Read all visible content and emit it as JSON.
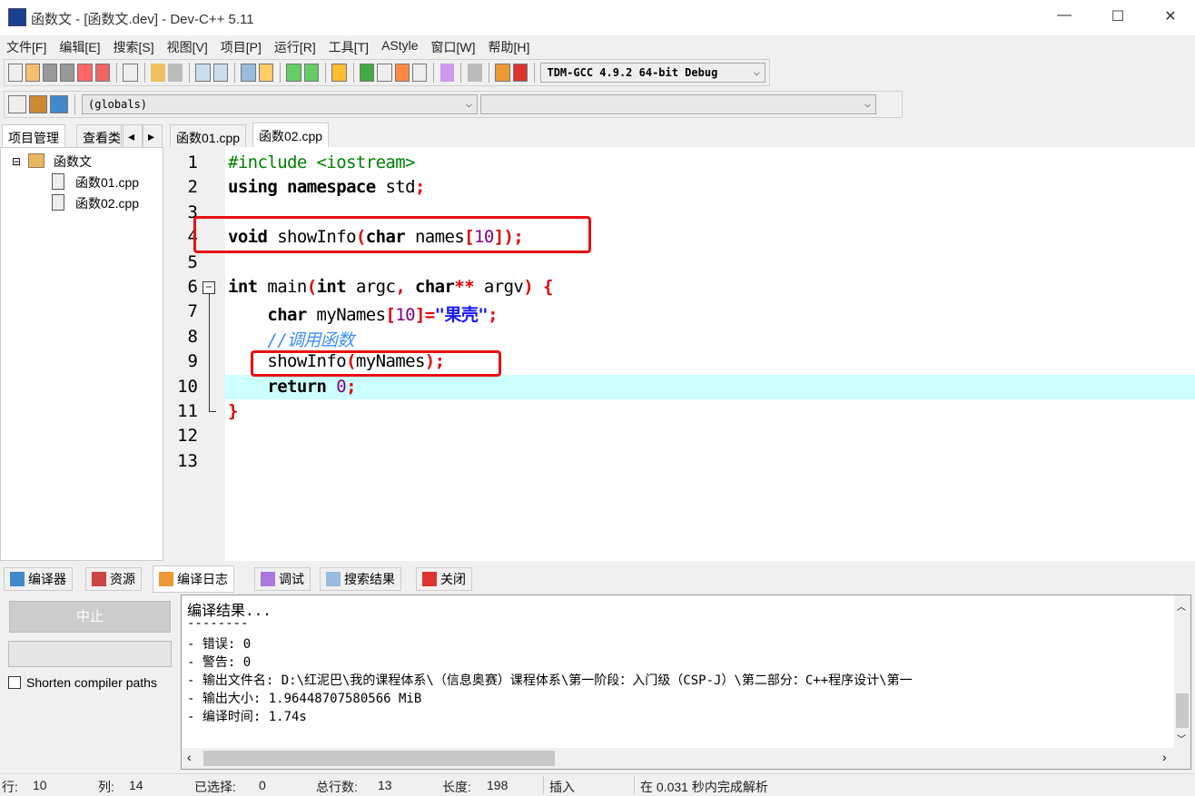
{
  "window": {
    "title": "函数文 - [函数文.dev] - Dev-C++ 5.11",
    "minimize": "—",
    "maximize": "☐",
    "close": "✕"
  },
  "menu": [
    "文件[F]",
    "编辑[E]",
    "搜索[S]",
    "视图[V]",
    "项目[P]",
    "运行[R]",
    "工具[T]",
    "AStyle",
    "窗口[W]",
    "帮助[H]"
  ],
  "toolbar": {
    "compiler": "TDM-GCC 4.9.2 64-bit Debug",
    "scope": "(globals)",
    "symbol": ""
  },
  "left_tabs": [
    "项目管理",
    "查看类"
  ],
  "project": {
    "name": "函数文",
    "files": [
      "函数01.cpp",
      "函数02.cpp"
    ]
  },
  "editor_tabs": [
    "函数01.cpp",
    "函数02.cpp"
  ],
  "active_tab": 1,
  "code": [
    [
      [
        "pp",
        "#include <iostream>"
      ]
    ],
    [
      [
        "kw",
        "using"
      ],
      [
        "id",
        " "
      ],
      [
        "kw",
        "namespace"
      ],
      [
        "id",
        " std"
      ],
      [
        "sym",
        ";"
      ]
    ],
    [],
    [
      [
        "kw",
        "void"
      ],
      [
        "id",
        " showInfo"
      ],
      [
        "sym",
        "("
      ],
      [
        "kw",
        "char"
      ],
      [
        "id",
        " names"
      ],
      [
        "sym",
        "["
      ],
      [
        "num",
        "10"
      ],
      [
        "sym",
        "]);"
      ]
    ],
    [],
    [
      [
        "kw",
        "int"
      ],
      [
        "id",
        " main"
      ],
      [
        "sym",
        "("
      ],
      [
        "kw",
        "int"
      ],
      [
        "id",
        " argc"
      ],
      [
        "sym",
        ", "
      ],
      [
        "kw",
        "char"
      ],
      [
        "sym",
        "**"
      ],
      [
        "id",
        " argv"
      ],
      [
        "sym",
        ")"
      ],
      [
        "id",
        " "
      ],
      [
        "sym",
        "{"
      ]
    ],
    [
      [
        "id",
        "    "
      ],
      [
        "kw",
        "char"
      ],
      [
        "id",
        " myNames"
      ],
      [
        "sym",
        "["
      ],
      [
        "num",
        "10"
      ],
      [
        "sym",
        "]="
      ],
      [
        "str",
        "\"果壳\""
      ],
      [
        "sym",
        ";"
      ]
    ],
    [
      [
        "id",
        "    "
      ],
      [
        "cm",
        "//调用函数"
      ]
    ],
    [
      [
        "id",
        "    showInfo"
      ],
      [
        "sym",
        "("
      ],
      [
        "id",
        "myNames"
      ],
      [
        "sym",
        ");"
      ]
    ],
    [
      [
        "id",
        "    "
      ],
      [
        "kw",
        "return"
      ],
      [
        "id",
        " "
      ],
      [
        "num",
        "0"
      ],
      [
        "sym",
        ";"
      ]
    ],
    [
      [
        "sym",
        "}"
      ]
    ],
    [],
    []
  ],
  "current_line": 10,
  "bottom_tabs": [
    "编译器",
    "资源",
    "编译日志",
    "调试",
    "搜索结果",
    "关闭"
  ],
  "log_panel": {
    "abort_button": "中止",
    "shorten_label": "Shorten compiler paths",
    "shorten_checked": false
  },
  "log": [
    "编译结果...",
    "--------",
    "- 错误: 0",
    "- 警告: 0",
    "- 输出文件名: D:\\红泥巴\\我的课程体系\\（信息奥赛）课程体系\\第一阶段：入门级（CSP-J）\\第二部分：C++程序设计\\第一",
    "- 输出大小: 1.96448707580566 MiB",
    "- 编译时间: 1.74s"
  ],
  "status": {
    "row_label": "行:",
    "row": "10",
    "col_label": "列:",
    "col": "14",
    "sel_label": "已选择:",
    "sel": "0",
    "total_label": "总行数:",
    "total": "13",
    "len_label": "长度:",
    "len": "198",
    "mode": "插入",
    "parse": "在 0.031 秒内完成解析"
  },
  "colors": {
    "highlight": "#ccffff",
    "annotation": "#e81010",
    "keyword": "#000000",
    "symbol": "#e00000",
    "number": "#800080",
    "string": "#1a1aff",
    "comment": "#3c8cff",
    "preprocessor": "#008000"
  }
}
